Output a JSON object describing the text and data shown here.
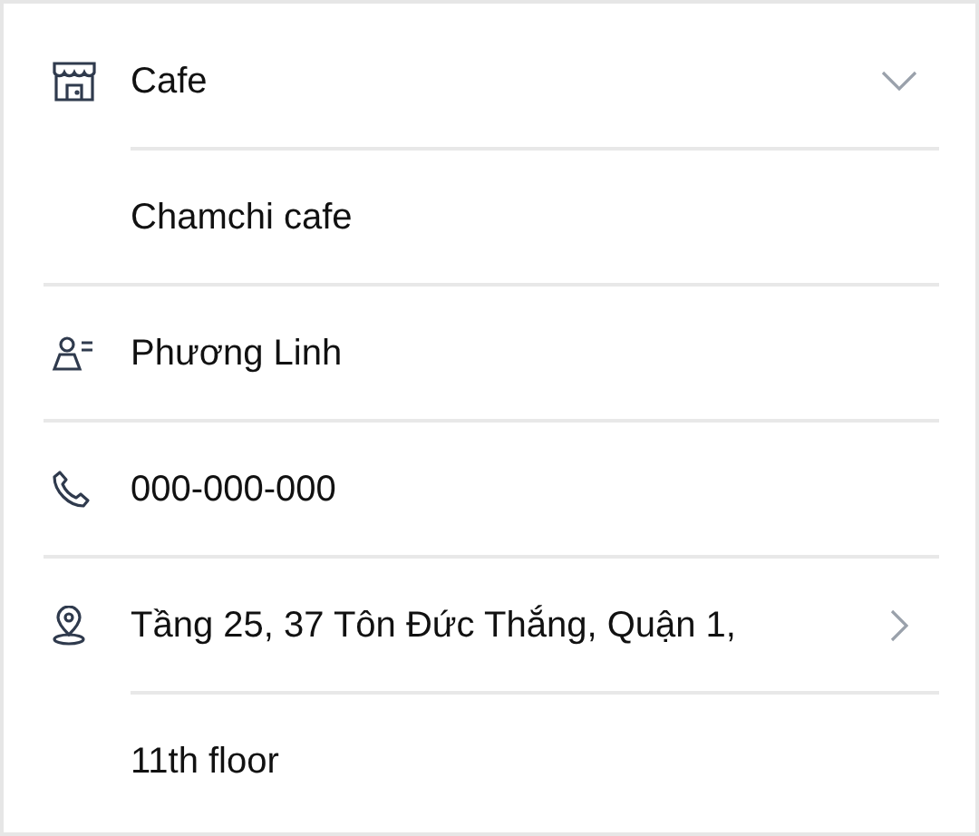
{
  "fields": [
    {
      "kind": "category",
      "value": "Cafe"
    },
    {
      "kind": "detail",
      "value": "Chamchi cafe"
    },
    {
      "kind": "contact",
      "value": "Phương Linh"
    },
    {
      "kind": "phone",
      "value": "000-000-000"
    },
    {
      "kind": "address",
      "value": "Tầng 25, 37 Tôn Đức Thắng, Quận 1,"
    },
    {
      "kind": "detail",
      "value": "11th floor"
    }
  ]
}
